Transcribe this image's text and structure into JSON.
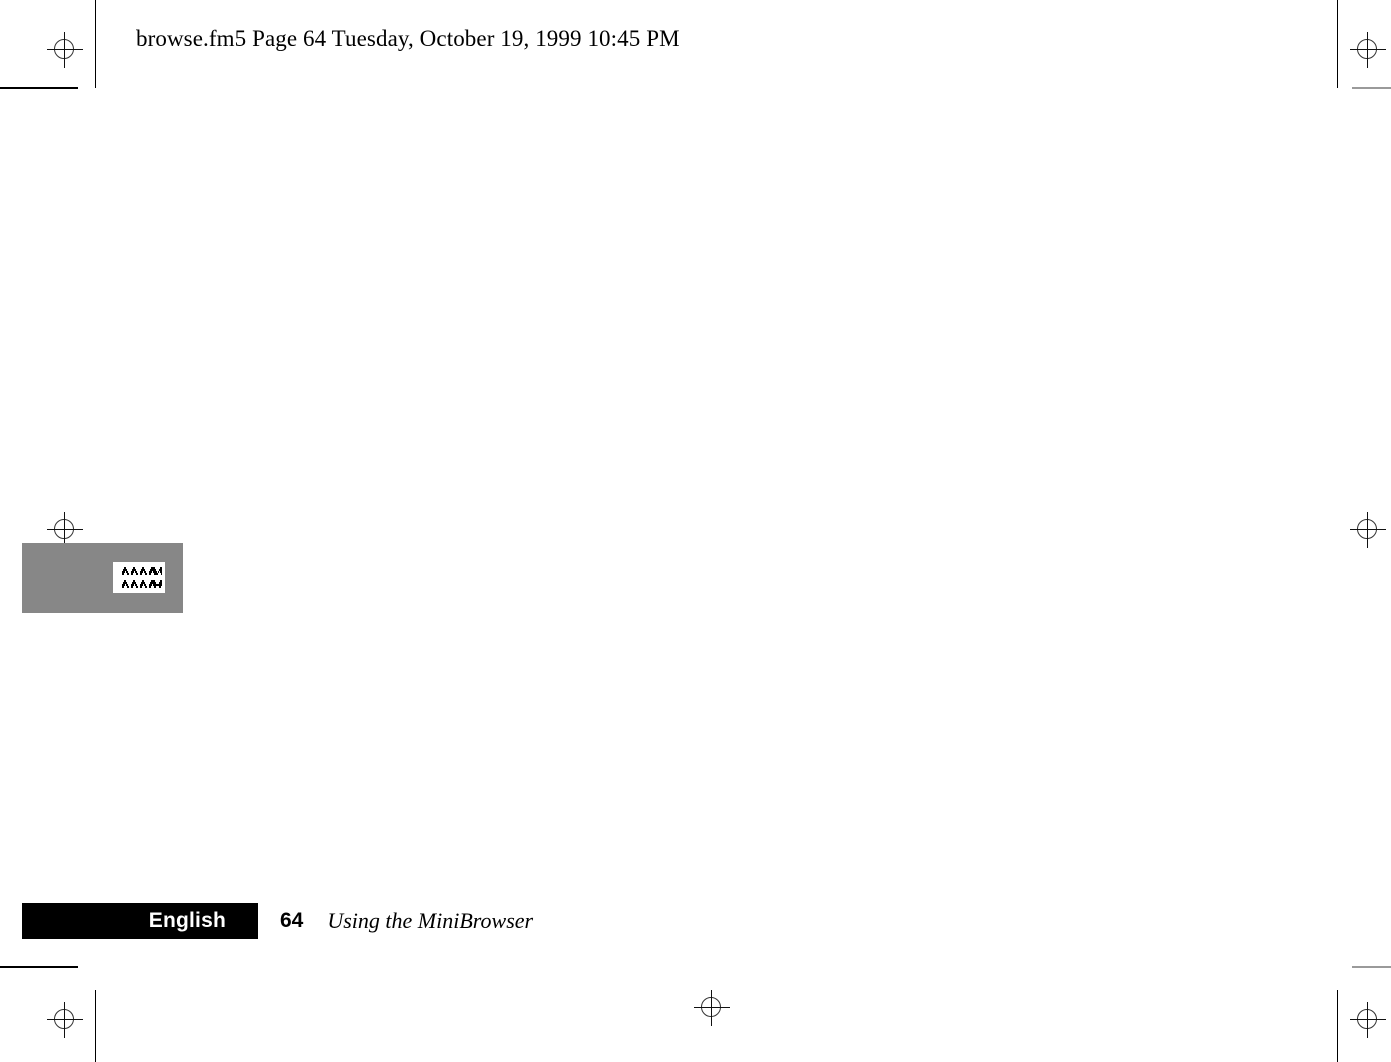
{
  "header": {
    "text": "browse.fm5  Page 64  Tuesday, October 19, 1999  10:45 PM"
  },
  "figure": {
    "icon_name": "www-icon",
    "background_color": "#878787",
    "icon_background_color": "#ffffff"
  },
  "footer": {
    "language_label": "English",
    "page_number": "64",
    "section_title": "Using the MiniBrowser",
    "bar_color": "#000000",
    "bar_text_color": "#ffffff"
  },
  "prepress": {
    "registration_mark_name": "registration-mark",
    "trim_mark_name": "trim-mark"
  }
}
